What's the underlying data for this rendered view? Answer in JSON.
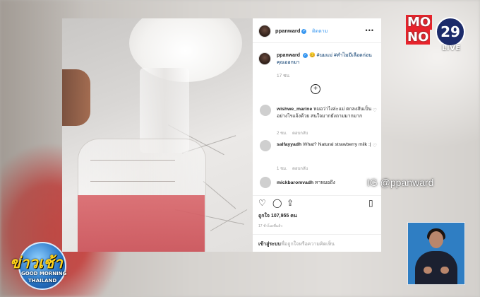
{
  "channel": {
    "logo_row1": "MO",
    "logo_row2": "NO",
    "logo_number": "29",
    "live_label": "LIVE",
    "brand_color": "#e8232b"
  },
  "instagram_credit": "IG @ppanward",
  "post": {
    "username": "ppanward",
    "follow_label": "ติดตาม",
    "more_label": "•••",
    "caption_user": "ppanward",
    "caption_text": "😊 #นมแม่ #ทำไมมีเลือดก่อนคุณออกมา",
    "time": "17 ชม.",
    "comments": [
      {
        "user": "wishwe_marine",
        "text": "หมอว่าไงล่ะแม่ ตกลงสันเป็นอย่างไรแจ้งด้วย สนใจมากยังถามมากมาก",
        "time": "2 ชม.",
        "reply": "ตอบกลับ"
      },
      {
        "user": "salfayyadh",
        "text": "What? Natural strawberry milk :|",
        "time": "1 ชม.",
        "reply": "ตอบกลับ"
      },
      {
        "user": "mickbaromvadh",
        "text": "หาหมอถึง",
        "time": "",
        "reply": ""
      }
    ],
    "likes": "ถูกใจ 107,955 คน",
    "date": "17 ชั่วโมงที่แล้ว",
    "add_comment_label": "เข้าสู่ระบบ",
    "add_comment_placeholder": "เพื่อถูกใจหรือความคิดเห็น",
    "icons": [
      "heart-icon",
      "comment-icon",
      "share-icon",
      "bookmark-icon"
    ]
  },
  "show": {
    "title": "ข่าวเช้า",
    "sub1": "GOOD MORNING",
    "sub2": "THAILAND"
  }
}
